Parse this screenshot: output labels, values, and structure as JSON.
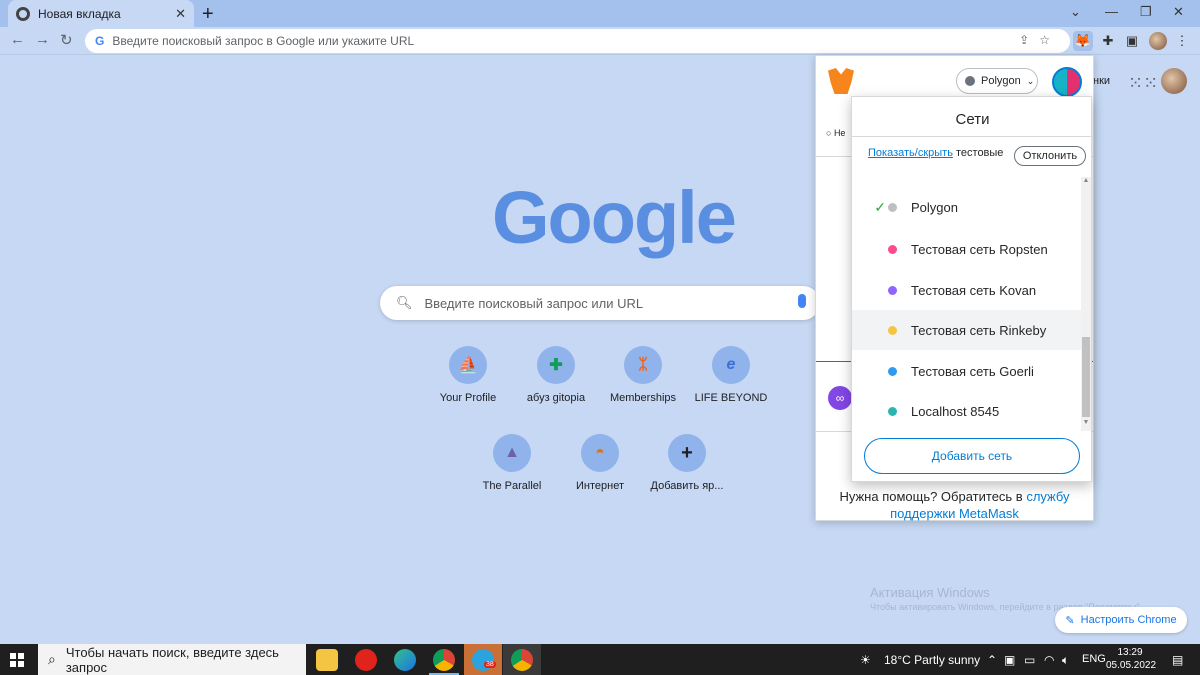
{
  "browser": {
    "tab_title": "Новая вкладка",
    "omnibox_placeholder": "Введите поисковый запрос в Google или укажите URL"
  },
  "ntp": {
    "logo_text": "Google",
    "search_placeholder": "Введите поисковый запрос или URL",
    "right_link_partial": "нки",
    "shortcuts": [
      {
        "label": "Your Profile",
        "icon": "sailboat-icon",
        "color": "#1e88e5"
      },
      {
        "label": "абуз gitopia",
        "icon": "plus-square-icon",
        "color": "#0f9d58"
      },
      {
        "label": "Memberships",
        "icon": "fnatic-icon",
        "color": "#ff5900"
      },
      {
        "label": "LIFE BEYOND",
        "icon": "e-icon",
        "color": "#3a6fd8"
      },
      {
        "label": "The Parallel",
        "icon": "parallel-icon",
        "color": "#6d5fa8"
      },
      {
        "label": "Интернет",
        "icon": "rainbow-icon",
        "color": "#e8710a"
      },
      {
        "label": "Добавить яр...",
        "icon": "plus-icon",
        "color": "#202124"
      }
    ],
    "customize_button": "Настроить Chrome",
    "windows_activation": {
      "title": "Активация Windows",
      "subtitle": "Чтобы активировать Windows, перейдите в раздел \"Параметры\"."
    }
  },
  "metamask": {
    "network_pill": "Polygon",
    "underlay_text": "Не",
    "help_text": "Нужна помощь? Обратитесь в ",
    "help_link": "службу поддержки MetaMask",
    "networks_dropdown": {
      "title": "Сети",
      "show_hide_link": "Показать/скрыть",
      "show_hide_rest": " тестовые",
      "dismiss_button": "Отклонить",
      "items": [
        {
          "name": "Polygon",
          "color": "#bbc0c5",
          "selected": true
        },
        {
          "name": "Тестовая сеть Ropsten",
          "color": "#ff4a8d",
          "selected": false
        },
        {
          "name": "Тестовая сеть Kovan",
          "color": "#9064ff",
          "selected": false
        },
        {
          "name": "Тестовая сеть Rinkeby",
          "color": "#f6c343",
          "selected": false
        },
        {
          "name": "Тестовая сеть Goerli",
          "color": "#3099f2",
          "selected": false
        },
        {
          "name": "Localhost 8545",
          "color": "#29b6af",
          "selected": false
        }
      ],
      "add_network_button": "Добавить сеть"
    }
  },
  "taskbar": {
    "search_placeholder": "Чтобы начать поиск, введите здесь запрос",
    "weather": "18°C  Partly sunny",
    "language": "ENG",
    "time": "13:29",
    "date": "05.05.2022",
    "telegram_badge": "38"
  }
}
